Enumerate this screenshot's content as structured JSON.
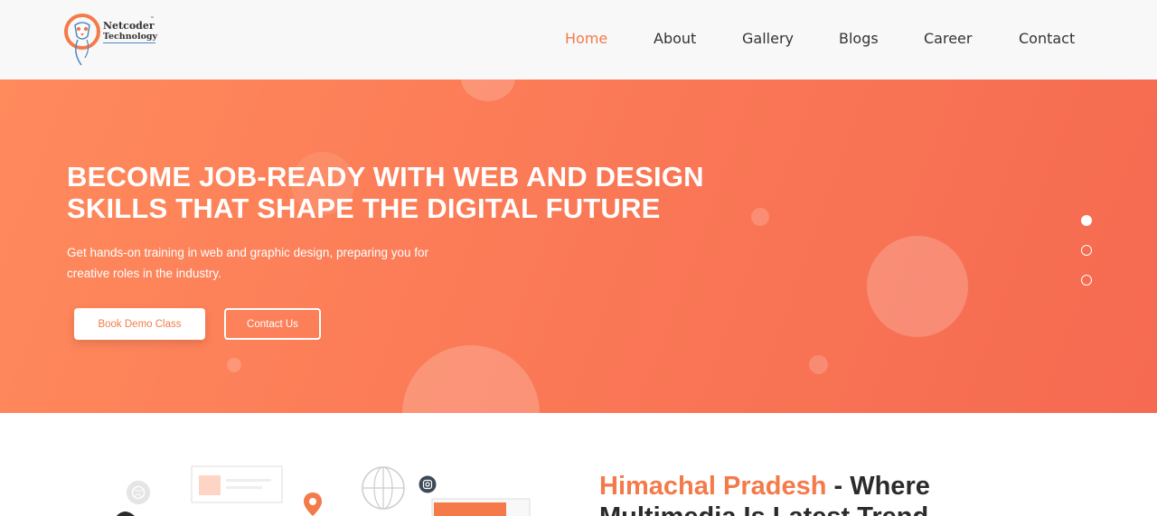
{
  "brand": {
    "line1": "Netcoder",
    "line2": "Technology",
    "tm": "™",
    "accent_color": "#f47a4a"
  },
  "nav": {
    "items": [
      {
        "label": "Home",
        "active": true
      },
      {
        "label": "About",
        "active": false
      },
      {
        "label": "Gallery",
        "active": false
      },
      {
        "label": "Blogs",
        "active": false
      },
      {
        "label": "Career",
        "active": false
      },
      {
        "label": "Contact",
        "active": false
      }
    ]
  },
  "hero": {
    "title_line1": "BECOME JOB-READY WITH WEB AND DESIGN",
    "title_line2": "SKILLS THAT SHAPE THE DIGITAL FUTURE",
    "subtitle_line1": "Get hands-on training in web and graphic design, preparing you for",
    "subtitle_line2": "creative roles in the industry.",
    "primary_button": "Book Demo Class",
    "secondary_button": "Contact Us",
    "gradient_start": "#ff8a5c",
    "gradient_end": "#f56a51",
    "slides": 3,
    "active_slide": 1
  },
  "section": {
    "heading_accent": "Himachal Pradesh",
    "heading_rest_line1": " - Where",
    "heading_line2": "Multimedia Is Latest Trend"
  },
  "icons": [
    "logo-icon",
    "dribbble-icon",
    "location-pin-icon",
    "globe-icon",
    "instagram-icon"
  ]
}
